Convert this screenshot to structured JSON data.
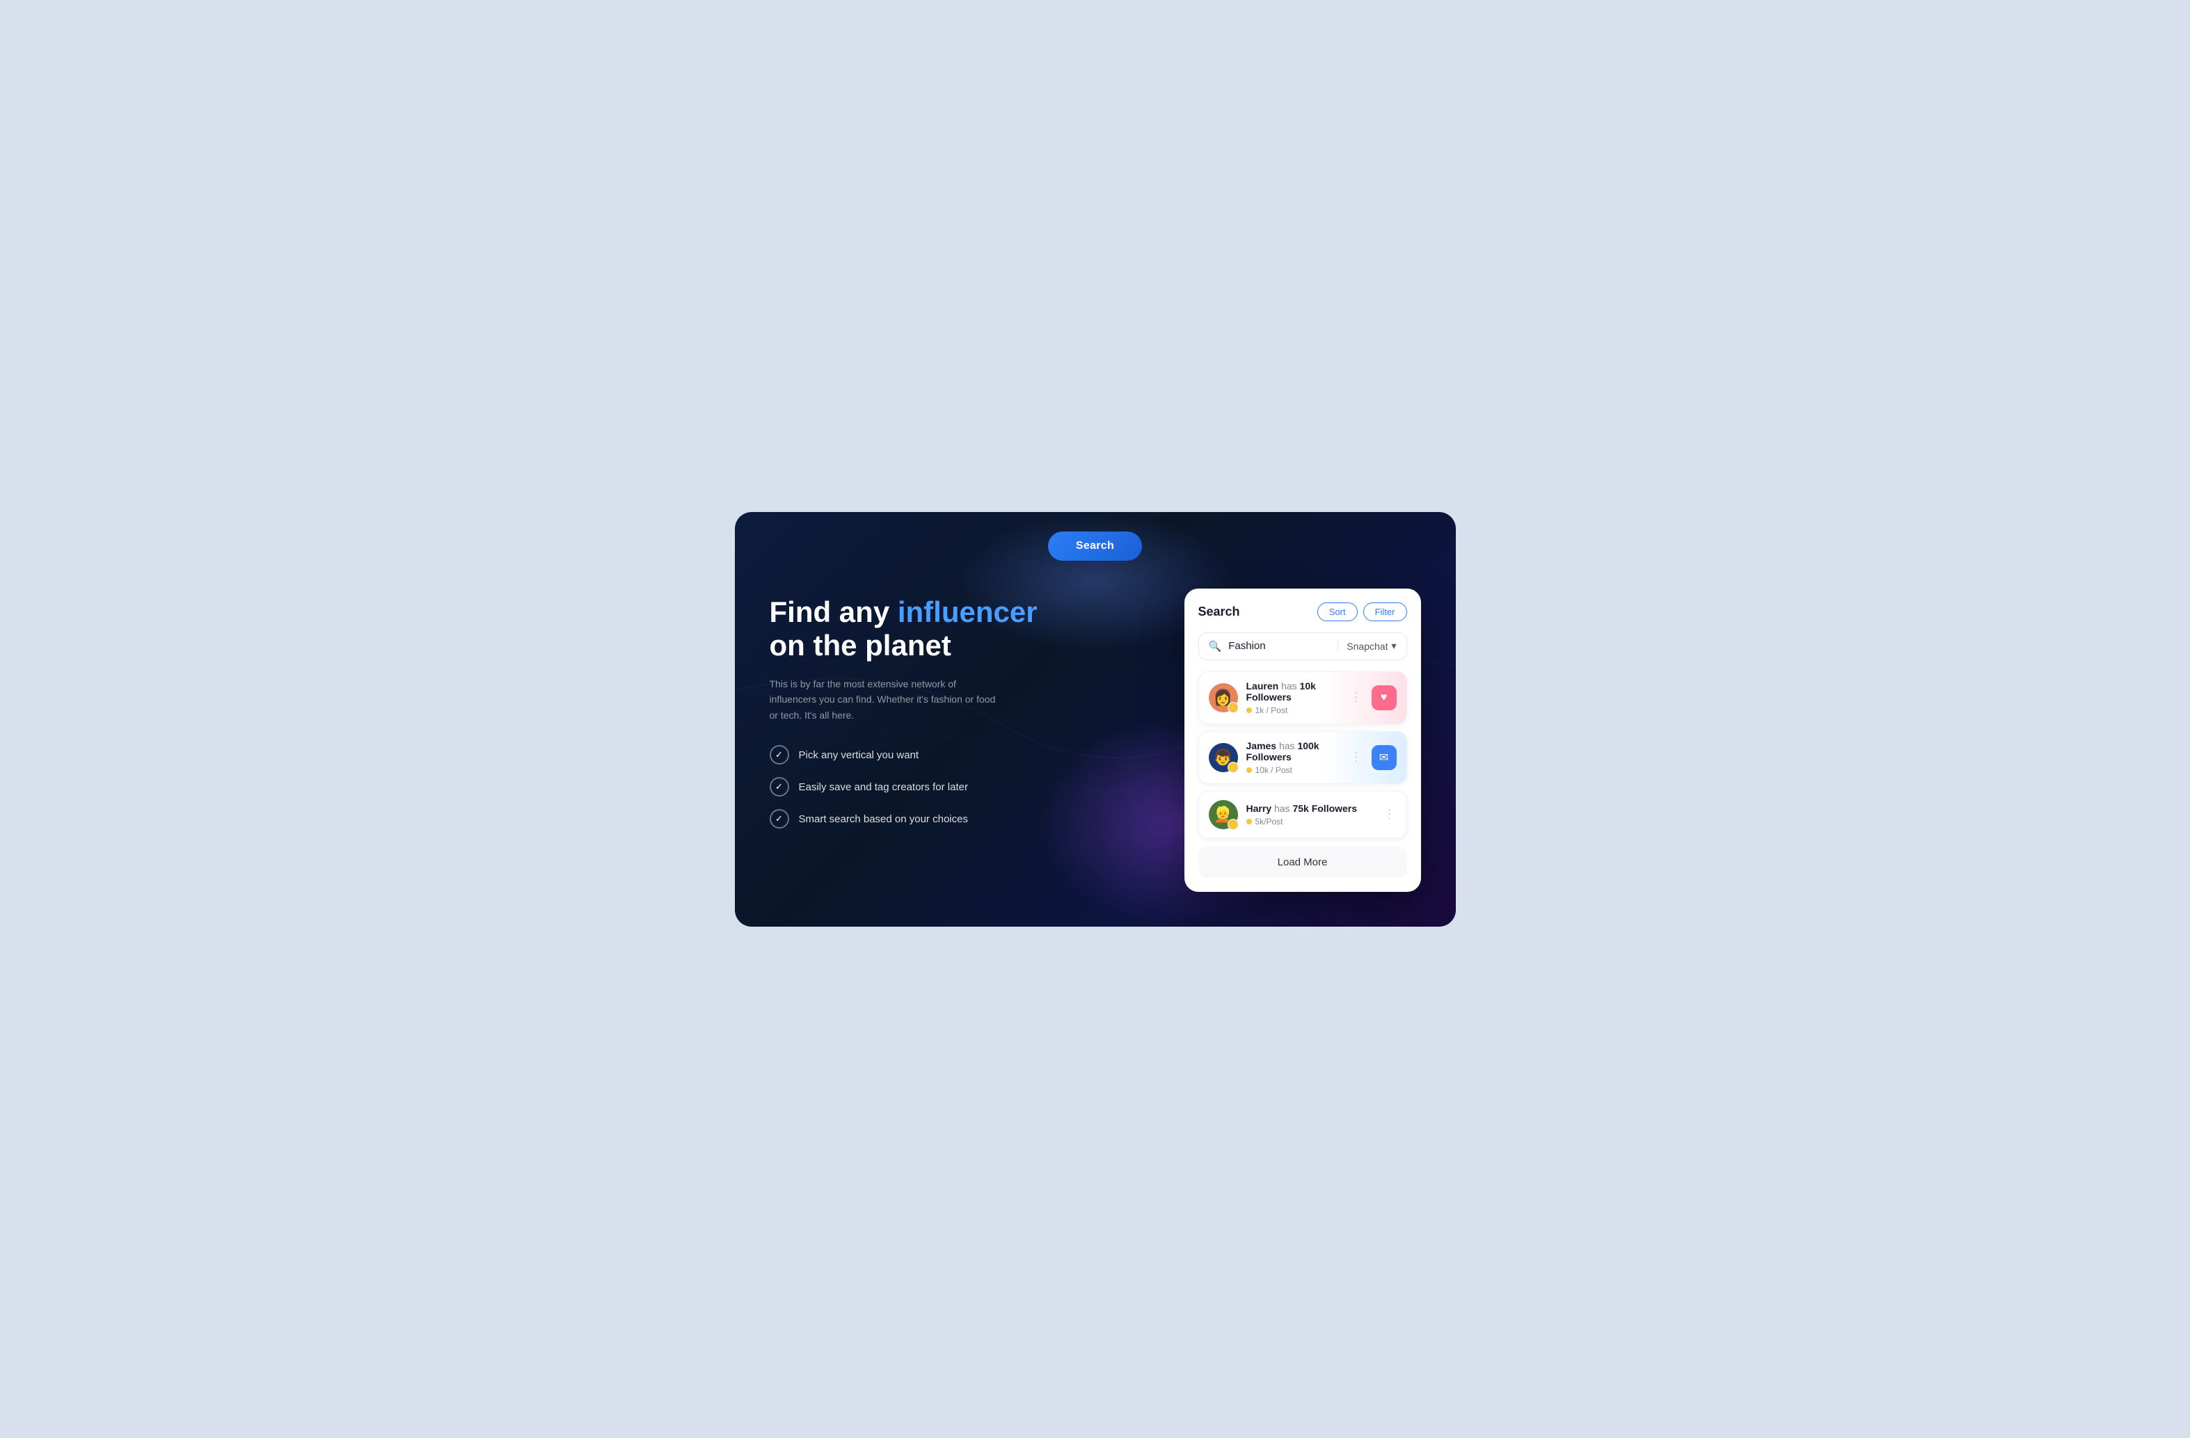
{
  "screen": {
    "search_button": "Search",
    "headline_part1": "Find any ",
    "headline_highlight": "influencer",
    "headline_part2": "on the planet",
    "subtitle": "This is by far the most extensive network of influencers you can find. Whether it's fashion or food or tech. It's all here.",
    "features": [
      "Pick any vertical you want",
      "Easily save and tag creators for later",
      "Smart search based on your choices"
    ]
  },
  "panel": {
    "title": "Search",
    "sort_label": "Sort",
    "filter_label": "Filter",
    "search_placeholder": "Fashion",
    "platform": "Snapchat",
    "load_more": "Load More",
    "influencers": [
      {
        "name": "Lauren",
        "has": "has",
        "followers": "10k Followers",
        "stat": "1k / Post",
        "action": "heart",
        "emoji": "👩",
        "avatar_bg": "#e8845a"
      },
      {
        "name": "James",
        "has": "has",
        "followers": "100k Followers",
        "stat": "10k / Post",
        "action": "message",
        "emoji": "👦",
        "avatar_bg": "#1a3a7a"
      },
      {
        "name": "Harry",
        "has": "has",
        "followers": "75k Followers",
        "stat": "5k/Post",
        "action": "none",
        "emoji": "👱",
        "avatar_bg": "#4a7a3a"
      }
    ]
  }
}
